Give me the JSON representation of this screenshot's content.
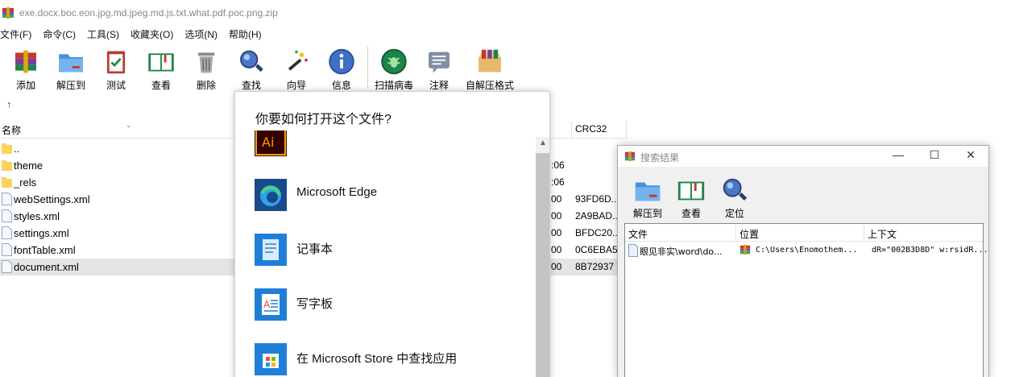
{
  "window": {
    "title": "exe.docx.boc.eon.jpg.md.jpeg.md.js.txt.what.pdf.poc.png.zip"
  },
  "menu": [
    "文件(F)",
    "命令(C)",
    "工具(S)",
    "收藏夹(O)",
    "选项(N)",
    "帮助(H)"
  ],
  "toolbar": {
    "add": "添加",
    "extract": "解压到",
    "test": "测试",
    "view": "查看",
    "delete": "删除",
    "find": "查找",
    "wizard": "向导",
    "info": "信息",
    "scan": "扫描病毒",
    "comment": "注释",
    "sfx": "自解压格式"
  },
  "up_arrow": "↑",
  "file_list": {
    "col_name": "名称",
    "col_crc": "CRC32",
    "rows": [
      {
        "name": "..",
        "type": "folder",
        "time": "",
        "crc": ""
      },
      {
        "name": "theme",
        "type": "folder",
        "time": ":06",
        "crc": ""
      },
      {
        "name": "_rels",
        "type": "folder",
        "time": ":06",
        "crc": ""
      },
      {
        "name": "webSettings.xml",
        "type": "file",
        "time": "00",
        "crc": "93FD6D..."
      },
      {
        "name": "styles.xml",
        "type": "file",
        "time": "00",
        "crc": "2A9BAD..."
      },
      {
        "name": "settings.xml",
        "type": "file",
        "time": "00",
        "crc": "BFDC20..."
      },
      {
        "name": "fontTable.xml",
        "type": "file",
        "time": "00",
        "crc": "0C6EBA5"
      },
      {
        "name": "document.xml",
        "type": "file",
        "time": "00",
        "crc": "8B72937",
        "selected": true
      }
    ]
  },
  "open_with": {
    "question": "你要如何打开这个文件?",
    "apps": [
      {
        "name": "",
        "icon": "illustrator-icon"
      },
      {
        "name": "Microsoft Edge",
        "icon": "edge-icon"
      },
      {
        "name": "记事本",
        "icon": "notepad-icon"
      },
      {
        "name": "写字板",
        "icon": "wordpad-icon"
      },
      {
        "name": "在 Microsoft Store 中查找应用",
        "icon": "store-icon"
      }
    ]
  },
  "search_results": {
    "title": "搜索结果",
    "buttons": {
      "extract": "解压到",
      "view": "查看",
      "locate": "定位"
    },
    "columns": {
      "file": "文件",
      "location": "位置",
      "context": "上下文"
    },
    "row": {
      "file": "眼见非实\\word\\do...",
      "location": "C:\\Users\\Enomothem...",
      "context": "dR=\"002B3D8D\" w:rsidR..."
    }
  },
  "colors": {
    "accent": "#0078d4",
    "folder": "#ffd15c",
    "selection": "#e5e5e5"
  }
}
